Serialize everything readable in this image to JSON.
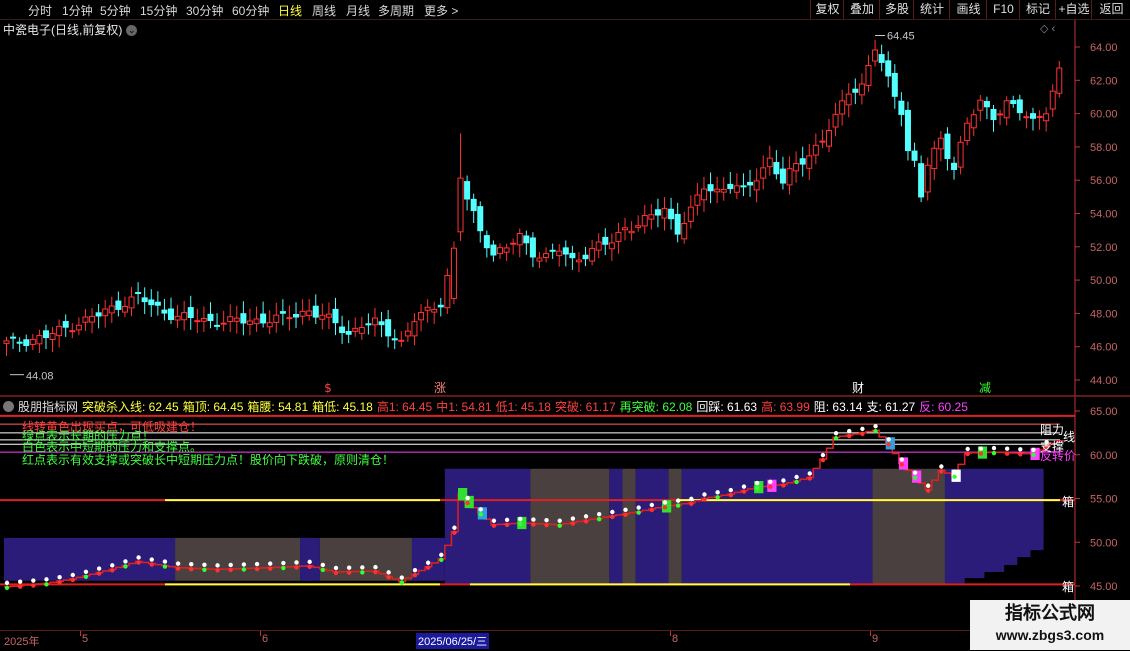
{
  "toolbar": {
    "periods": [
      "分时",
      "1分钟",
      "5分钟",
      "15分钟",
      "30分钟",
      "60分钟",
      "日线",
      "周线",
      "月线",
      "多周期",
      "更多 >"
    ],
    "active_period": "日线",
    "right_buttons": [
      "复权",
      "叠加",
      "多股",
      "统计",
      "画线",
      "F10",
      "标记",
      "+自选",
      "返回"
    ]
  },
  "chart": {
    "title": "中瓷电子(日线,前复权)",
    "corner_icons": "◇ ‹",
    "y_axis_labels": [
      "64.00",
      "62.00",
      "60.00",
      "58.00",
      "56.00",
      "54.00",
      "52.00",
      "50.00",
      "48.00",
      "46.00",
      "44.00"
    ],
    "high_label": "64.45",
    "low_label": "44.08",
    "event_markers": [
      {
        "text": "$",
        "color": "#ff4040"
      },
      {
        "text": "涨",
        "color": "#ff8080"
      },
      {
        "text": "财",
        "color": "#ffffff"
      },
      {
        "text": "减",
        "color": "#30ff30"
      }
    ],
    "colors": {
      "up": "#ff3232",
      "down": "#54ffff",
      "bg": "#000000",
      "axis": "#c83232"
    }
  },
  "indicator": {
    "name": "股朋指标网",
    "values": [
      {
        "text": "突破杀入线: 62.45",
        "color": "#ffff40"
      },
      {
        "text": "箱顶: 64.45",
        "color": "#ffff40"
      },
      {
        "text": "箱腰: 54.81",
        "color": "#ffff40"
      },
      {
        "text": "箱低: 45.18",
        "color": "#ffff40"
      },
      {
        "text": "高1: 64.45",
        "color": "#ff4040"
      },
      {
        "text": "中1: 54.81",
        "color": "#ff4040"
      },
      {
        "text": "低1: 45.18",
        "color": "#ff4040"
      },
      {
        "text": "突破: 61.17",
        "color": "#ff4040"
      },
      {
        "text": "再突破: 62.08",
        "color": "#40ff40"
      },
      {
        "text": "回踩: 61.63",
        "color": "#ffffff"
      },
      {
        "text": "高: 63.99",
        "color": "#ff4040"
      },
      {
        "text": "阻: 63.14",
        "color": "#ffffff"
      },
      {
        "text": "支: 61.27",
        "color": "#ffffff"
      },
      {
        "text": "反: 60.25",
        "color": "#ff40ff"
      }
    ],
    "notes": [
      {
        "text": "线转黄色出现买点，可低吸建仓！",
        "color": "#ff4040"
      },
      {
        "text": "绿点表示长期的压力点！",
        "color": "#40ff40"
      },
      {
        "text": "白色表示中短期的压力和支撑点。",
        "color": "#40ff40"
      },
      {
        "text": "红点表示有效支撑或突破长中短期压力点！股价向下跌破，原则清仓！",
        "color": "#40ff40"
      }
    ],
    "right_labels": [
      {
        "text": "阻力",
        "color": "#ffffff"
      },
      {
        "text": "线",
        "color": "#ffffff"
      },
      {
        "text": "支撑",
        "color": "#ffffff"
      },
      {
        "text": "反转价",
        "color": "#ff40ff"
      },
      {
        "text": "箱",
        "color": "#ffffff"
      },
      {
        "text": "箱",
        "color": "#ffffff"
      }
    ],
    "y_axis_labels": [
      "65.00",
      "60.00",
      "55.00",
      "50.00",
      "45.00"
    ]
  },
  "dates": {
    "labels": [
      "2025年",
      "5",
      "6",
      "7",
      "8",
      "9"
    ],
    "selected": "2025/06/25/三"
  },
  "watermark": {
    "line1": "指标公式网",
    "line2": "www.zbgs3.com"
  }
}
